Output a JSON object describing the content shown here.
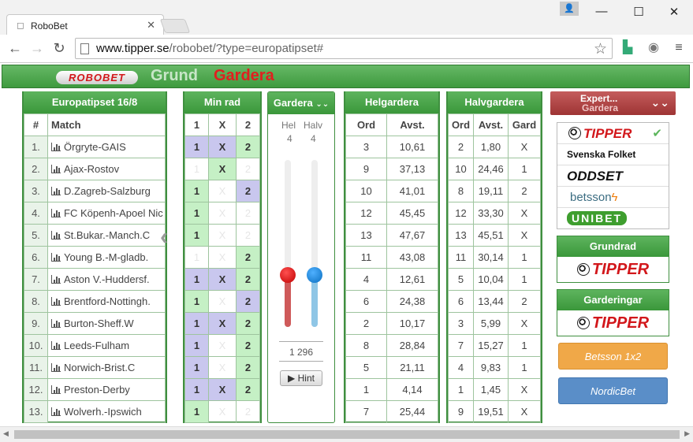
{
  "browser": {
    "tab_title": "RoboBet",
    "url_domain": "www.tipper.se",
    "url_path": "/robobet/?type=europatipset#"
  },
  "header": {
    "logo": "ROBOBET",
    "tab_grund": "Grund",
    "tab_gardera": "Gardera"
  },
  "match_panel": {
    "title": "Europatipset 16/8",
    "col_num": "#",
    "col_match": "Match",
    "rows": [
      {
        "n": "1.",
        "m": "Örgryte-GAIS"
      },
      {
        "n": "2.",
        "m": "Ajax-Rostov"
      },
      {
        "n": "3.",
        "m": "D.Zagreb-Salzburg"
      },
      {
        "n": "4.",
        "m": "FC Köpenh-Apoel Nic"
      },
      {
        "n": "5.",
        "m": "St.Bukar.-Manch.C"
      },
      {
        "n": "6.",
        "m": "Young B.-M-gladb."
      },
      {
        "n": "7.",
        "m": "Aston V.-Huddersf."
      },
      {
        "n": "8.",
        "m": "Brentford-Nottingh."
      },
      {
        "n": "9.",
        "m": "Burton-Sheff.W"
      },
      {
        "n": "10.",
        "m": "Leeds-Fulham"
      },
      {
        "n": "11.",
        "m": "Norwich-Brist.C"
      },
      {
        "n": "12.",
        "m": "Preston-Derby"
      },
      {
        "n": "13.",
        "m": "Wolverh.-Ipswich"
      }
    ]
  },
  "minrad": {
    "title": "Min rad",
    "h1": "1",
    "hx": "X",
    "h2": "2",
    "rows": [
      [
        "1b",
        "Xb",
        "2g"
      ],
      [
        "1o",
        "Xg",
        "2o"
      ],
      [
        "1g",
        "Xo",
        "2b"
      ],
      [
        "1g",
        "Xo",
        "2o"
      ],
      [
        "1g",
        "Xo",
        "2o"
      ],
      [
        "1o",
        "Xo",
        "2g"
      ],
      [
        "1b",
        "Xb",
        "2g"
      ],
      [
        "1g",
        "Xo",
        "2b"
      ],
      [
        "1b",
        "Xb",
        "2g"
      ],
      [
        "1b",
        "Xo",
        "2g"
      ],
      [
        "1b",
        "Xo",
        "2g"
      ],
      [
        "1b",
        "Xb",
        "2g"
      ],
      [
        "1g",
        "Xo",
        "2o"
      ]
    ]
  },
  "gardera": {
    "title": "Gardera",
    "hel_label": "Hel",
    "halv_label": "Halv",
    "hel_value": "4",
    "halv_value": "4",
    "rows_count": "1 296",
    "hint": "Hint"
  },
  "helgardera": {
    "title": "Helgardera",
    "col_ord": "Ord",
    "col_avst": "Avst.",
    "rows": [
      [
        "3",
        "10,61"
      ],
      [
        "9",
        "37,13"
      ],
      [
        "10",
        "41,01"
      ],
      [
        "12",
        "45,45"
      ],
      [
        "13",
        "47,67"
      ],
      [
        "11",
        "43,08"
      ],
      [
        "4",
        "12,61"
      ],
      [
        "6",
        "24,38"
      ],
      [
        "2",
        "10,17"
      ],
      [
        "8",
        "28,84"
      ],
      [
        "5",
        "21,11"
      ],
      [
        "1",
        "4,14"
      ],
      [
        "7",
        "25,44"
      ]
    ]
  },
  "halvgardera": {
    "title": "Halvgardera",
    "col_ord": "Ord",
    "col_avst": "Avst.",
    "col_gard": "Gard",
    "rows": [
      [
        "2",
        "1,80",
        "X"
      ],
      [
        "10",
        "24,46",
        "1"
      ],
      [
        "8",
        "19,11",
        "2"
      ],
      [
        "12",
        "33,30",
        "X"
      ],
      [
        "13",
        "45,51",
        "X"
      ],
      [
        "11",
        "30,14",
        "1"
      ],
      [
        "5",
        "10,04",
        "1"
      ],
      [
        "6",
        "13,44",
        "2"
      ],
      [
        "3",
        "5,99",
        "X"
      ],
      [
        "7",
        "15,27",
        "1"
      ],
      [
        "4",
        "9,83",
        "1"
      ],
      [
        "1",
        "1,45",
        "X"
      ],
      [
        "9",
        "19,51",
        "X"
      ]
    ]
  },
  "sidebar": {
    "expert_title": "Expert...",
    "expert_sub": "Gardera",
    "experts": [
      "TIPPER",
      "Svenska Folket",
      "ODDSET",
      "betsson",
      "UNIBET"
    ],
    "grundrad_title": "Grundrad",
    "grundrad_brand": "TIPPER",
    "garderingar_title": "Garderingar",
    "garderingar_brand": "TIPPER",
    "betsson_btn": "Betsson 1x2",
    "nordicbet_btn": "NordicBet"
  }
}
